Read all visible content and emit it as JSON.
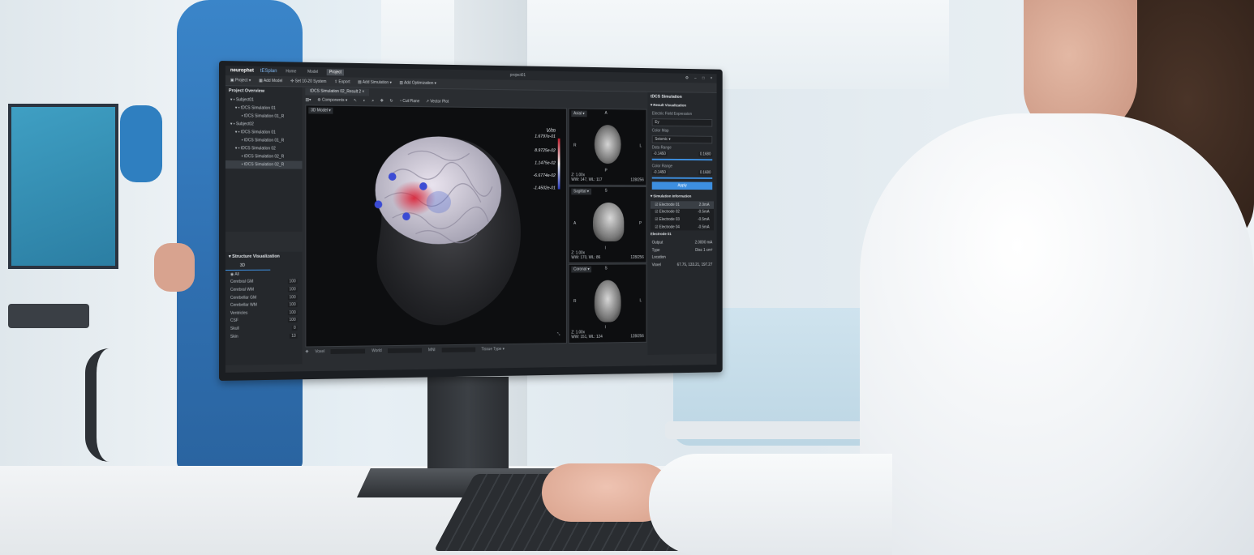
{
  "app": {
    "brand": "neurophet",
    "product": "tESplan",
    "nav": [
      "Home",
      "Model",
      "Project"
    ],
    "active_nav": "Project",
    "window_title": "project01"
  },
  "toolbar": {
    "project": "Project",
    "add_model": "Add Model",
    "set_system": "Set 10-20 System",
    "export": "Export",
    "add_simulation": "Add Simulation",
    "add_optimization": "Add Optimization"
  },
  "overview": {
    "title": "Project Overview",
    "items": [
      "Subject01",
      "tDCS Simulation 01",
      "tDCS Simulation 01_R",
      "Subject02",
      "tDCS Simulation 01",
      "tDCS Simulation 01_R",
      "tDCS Simulation 02",
      "tDCS Simulation 02_R",
      "tDCS Simulation 02_R"
    ]
  },
  "structure": {
    "title": "Structure Visualization",
    "tab": "3D",
    "all_label": "All",
    "rows": [
      {
        "label": "Cerebral GM",
        "value": "100"
      },
      {
        "label": "Cerebral WM",
        "value": "100"
      },
      {
        "label": "Cerebellar GM",
        "value": "100"
      },
      {
        "label": "Cerebellar WM",
        "value": "100"
      },
      {
        "label": "Ventricles",
        "value": "100"
      },
      {
        "label": "CSF",
        "value": "100"
      },
      {
        "label": "Skull",
        "value": "0"
      },
      {
        "label": "Skin",
        "value": "13"
      }
    ]
  },
  "doc_tab": "tDCS Simulation 02_Result 2",
  "view_toolbar": {
    "components": "Components",
    "cut_plane": "Cut Plane",
    "vector_plot": "Vector Plot"
  },
  "main_view": {
    "mode": "3D Model",
    "unit": "V/m",
    "legend": [
      "1.6797e-01",
      "8.9725e-02",
      "1.1475e-02",
      "-6.6774e-02",
      "-1.4502e-01"
    ]
  },
  "slices": [
    {
      "name": "Axial",
      "top": "A",
      "left": "R",
      "right": "L",
      "bottom": "P",
      "zoom": "Z: 1.00x",
      "wwwl": "WW: 147, WL: 117",
      "slice": "128/256"
    },
    {
      "name": "Sagittal",
      "top": "S",
      "left": "A",
      "right": "P",
      "bottom": "I",
      "zoom": "Z: 1.00x",
      "wwwl": "WW: 170, WL: 86",
      "slice": "128/256"
    },
    {
      "name": "Coronal",
      "top": "S",
      "left": "R",
      "right": "L",
      "bottom": "I",
      "zoom": "Z: 1.00x",
      "wwwl": "WW: 151, WL: 124",
      "slice": "128/256"
    }
  ],
  "status_bar": {
    "voxel": "Voxel",
    "world": "World",
    "mni": "MNI",
    "tissue": "Tissue Type"
  },
  "right_panel": {
    "title": "tDCS Simulation",
    "result_section": "Result Visualization",
    "field_label": "Electric Field Expression",
    "field_value": "Ey",
    "colormap_label": "Color Map",
    "colormap_value": "Seismic",
    "data_range_label": "Data Range",
    "data_min": "-0.1450",
    "data_max": "0.1680",
    "color_range_label": "Color Range",
    "color_min": "-0.1450",
    "color_max": "0.1680",
    "apply": "Apply",
    "sim_section": "Simulation Information",
    "electrodes": [
      {
        "name": "Electrode 01",
        "value": "2.0mA"
      },
      {
        "name": "Electrode 02",
        "value": "-0.5mA"
      },
      {
        "name": "Electrode 03",
        "value": "-0.5mA"
      },
      {
        "name": "Electrode 04",
        "value": "-0.5mA"
      }
    ],
    "detail_title": "Electrode 01",
    "output_label": "Output",
    "output_value": "2.0000",
    "output_unit": "mA",
    "type_label": "Type",
    "type_value": "Disc 1 cm²",
    "location_label": "Location",
    "voxel_label": "Voxel",
    "voxel_value": "67.75, 133.21, 197.27"
  },
  "colors": {
    "accent": "#3d8fe0",
    "ui_bg": "#2a2d31",
    "scrubs": "#2f6fb0"
  }
}
